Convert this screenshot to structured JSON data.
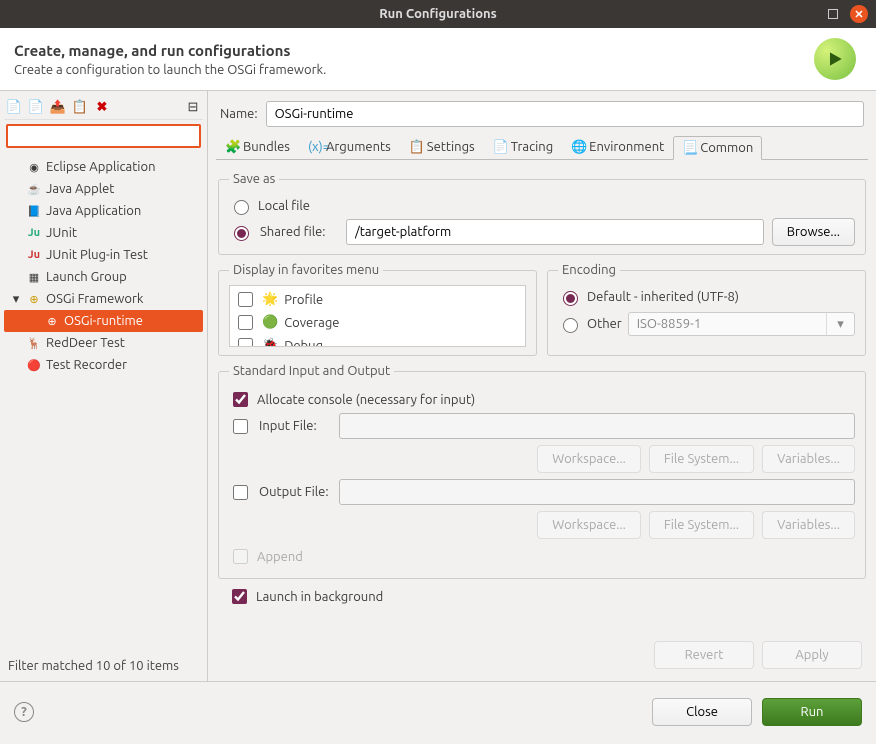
{
  "window": {
    "title": "Run Configurations"
  },
  "header": {
    "title": "Create, manage, and run configurations",
    "subtitle": "Create a configuration to launch the OSGi framework."
  },
  "filter_status": "Filter matched 10 of 10 items",
  "tree": {
    "items": [
      "Eclipse Application",
      "Java Applet",
      "Java Application",
      "JUnit",
      "JUnit Plug-in Test",
      "Launch Group"
    ],
    "framework": "OSGi Framework",
    "selected": "OSGi-runtime",
    "after": [
      "RedDeer Test",
      "Test Recorder"
    ]
  },
  "form": {
    "name_label": "Name:",
    "name_value": "OSGi-runtime",
    "tabs": [
      "Bundles",
      "Arguments",
      "Settings",
      "Tracing",
      "Environment",
      "Common"
    ],
    "save_as": {
      "legend": "Save as",
      "local": "Local file",
      "shared_label": "Shared file:",
      "shared_value": "/target-platform",
      "browse": "Browse..."
    },
    "favorites": {
      "legend": "Display in favorites menu",
      "items": [
        "Profile",
        "Coverage",
        "Debug"
      ]
    },
    "encoding": {
      "legend": "Encoding",
      "default": "Default - inherited (UTF-8)",
      "other": "Other",
      "other_value": "ISO-8859-1"
    },
    "stdio": {
      "legend": "Standard Input and Output",
      "allocate": "Allocate console (necessary for input)",
      "input_file": "Input File:",
      "output_file": "Output File:",
      "workspace": "Workspace...",
      "filesystem": "File System...",
      "variables": "Variables...",
      "append": "Append"
    },
    "launch_bg": "Launch in background",
    "revert": "Revert",
    "apply": "Apply"
  },
  "footer": {
    "close": "Close",
    "run": "Run"
  }
}
